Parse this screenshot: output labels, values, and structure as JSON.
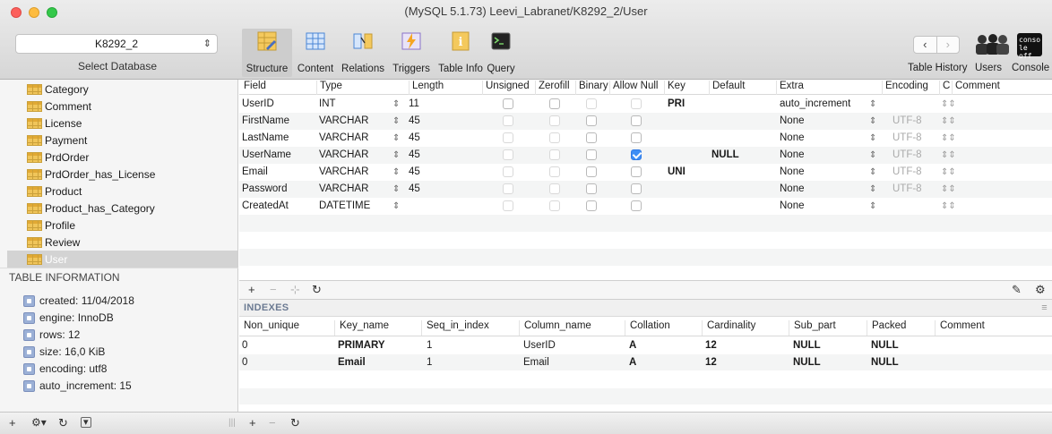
{
  "window": {
    "title": "(MySQL 5.1.73) Leevi_Labranet/K8292_2/User"
  },
  "database_selector": {
    "value": "K8292_2",
    "caption": "Select Database"
  },
  "toolbar": {
    "structure": "Structure",
    "content": "Content",
    "relations": "Relations",
    "triggers": "Triggers",
    "table_info": "Table Info",
    "query": "Query",
    "table_history": "Table History",
    "users": "Users",
    "console": "Console",
    "console_icon_text": "conso le off"
  },
  "sidebar": {
    "tables": [
      "Category",
      "Comment",
      "License",
      "Payment",
      "PrdOrder",
      "PrdOrder_has_License",
      "Product",
      "Product_has_Category",
      "Profile",
      "Review",
      "User"
    ],
    "selected_table": "User",
    "info_title": "TABLE INFORMATION",
    "info": [
      "created: 11/04/2018",
      "engine: InnoDB",
      "rows: 12",
      "size: 16,0 KiB",
      "encoding: utf8",
      "auto_increment: 15"
    ]
  },
  "structure": {
    "columns": [
      "Field",
      "Type",
      "Length",
      "Unsigned",
      "Zerofill",
      "Binary",
      "Allow Null",
      "Key",
      "Default",
      "Extra",
      "Encoding",
      "C",
      "Comment"
    ],
    "rows": [
      {
        "field": "UserID",
        "type": "INT",
        "length": "11",
        "allow_null": false,
        "key": "PRI",
        "default": "",
        "extra": "auto_increment",
        "encoding": ""
      },
      {
        "field": "FirstName",
        "type": "VARCHAR",
        "length": "45",
        "allow_null": false,
        "key": "",
        "default": "",
        "extra": "None",
        "encoding": "UTF-8"
      },
      {
        "field": "LastName",
        "type": "VARCHAR",
        "length": "45",
        "allow_null": false,
        "key": "",
        "default": "",
        "extra": "None",
        "encoding": "UTF-8"
      },
      {
        "field": "UserName",
        "type": "VARCHAR",
        "length": "45",
        "allow_null": true,
        "key": "",
        "default": "NULL",
        "extra": "None",
        "encoding": "UTF-8"
      },
      {
        "field": "Email",
        "type": "VARCHAR",
        "length": "45",
        "allow_null": false,
        "key": "UNI",
        "default": "",
        "extra": "None",
        "encoding": "UTF-8"
      },
      {
        "field": "Password",
        "type": "VARCHAR",
        "length": "45",
        "allow_null": false,
        "key": "",
        "default": "",
        "extra": "None",
        "encoding": "UTF-8"
      },
      {
        "field": "CreatedAt",
        "type": "DATETIME",
        "length": "",
        "allow_null": false,
        "key": "",
        "default": "",
        "extra": "None",
        "encoding": ""
      }
    ]
  },
  "indexes": {
    "title": "INDEXES",
    "columns": [
      "Non_unique",
      "Key_name",
      "Seq_in_index",
      "Column_name",
      "Collation",
      "Cardinality",
      "Sub_part",
      "Packed",
      "Comment"
    ],
    "rows": [
      [
        "0",
        "PRIMARY",
        "1",
        "UserID",
        "A",
        "12",
        "NULL",
        "NULL",
        ""
      ],
      [
        "0",
        "Email",
        "1",
        "Email",
        "A",
        "12",
        "NULL",
        "NULL",
        ""
      ]
    ]
  },
  "colors": {
    "accent": "#3d8ef5",
    "selection": "#d3d3d3",
    "index_title": "#6b7a92"
  }
}
